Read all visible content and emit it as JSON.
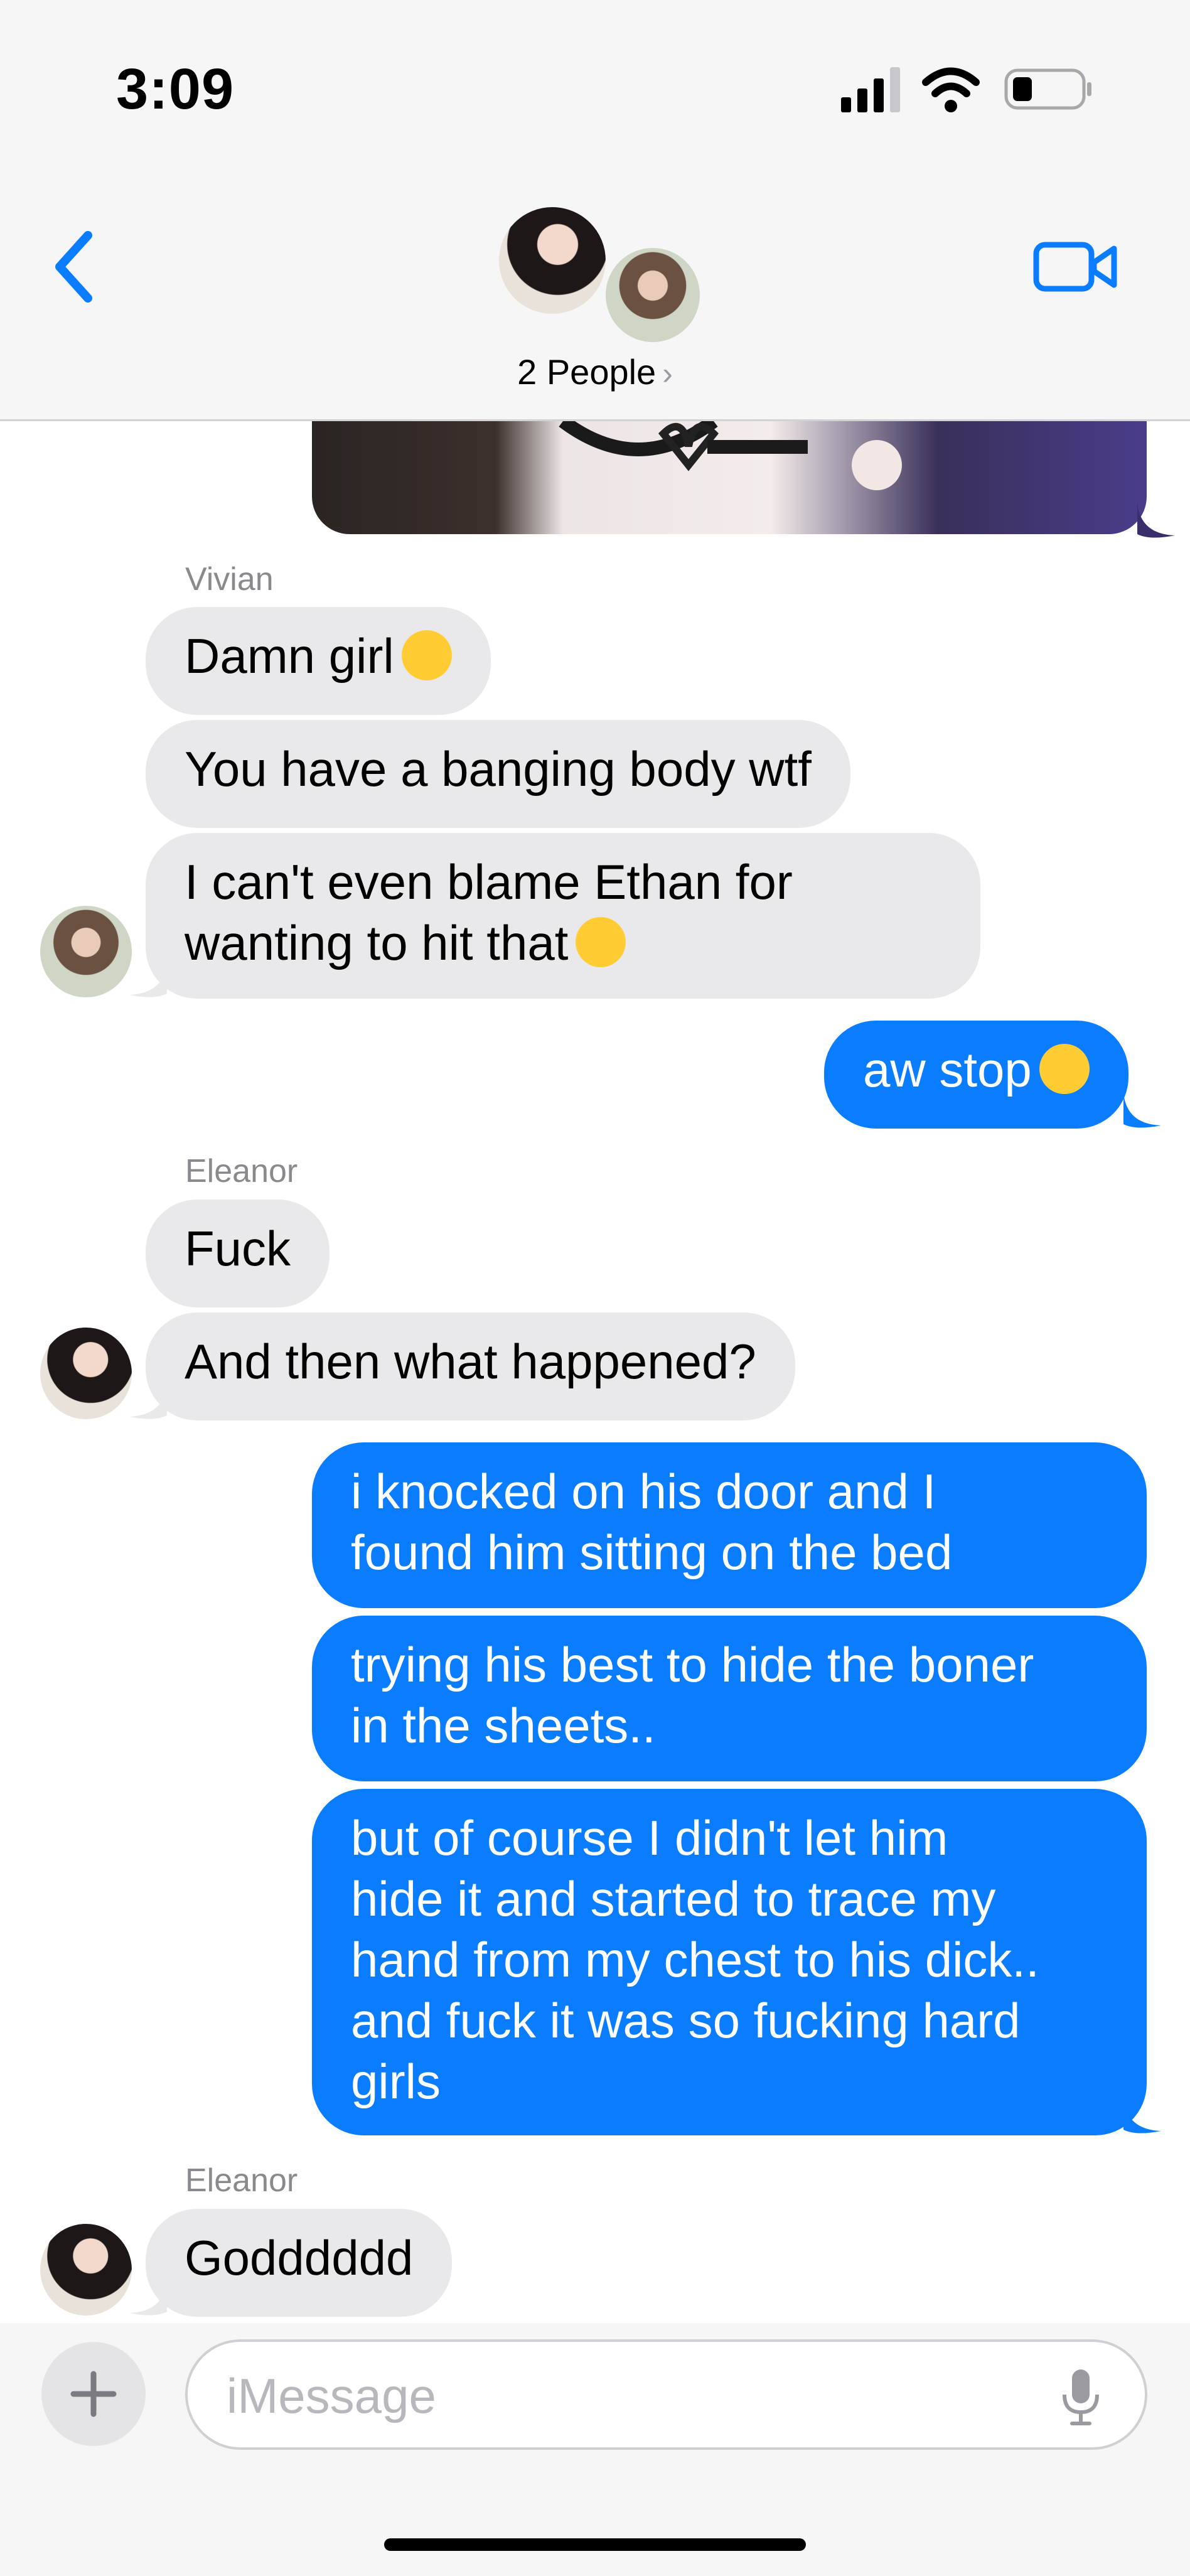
{
  "status_bar": {
    "time": "3:09",
    "battery_level": 0.25,
    "cellular_bars": 4,
    "wifi": "full"
  },
  "header": {
    "title": "2 People",
    "back_icon": "chevron-left-icon",
    "video_icon": "video-camera-icon"
  },
  "conversation": {
    "group_1": {
      "sender": "Vivian",
      "messages": [
        "Damn girl",
        "You have a banging body wtf",
        "I can't even blame Ethan for",
        "wanting to hit that"
      ],
      "emojis": [
        "face-exhaling-emoji",
        "woozy-face-emoji"
      ]
    },
    "out_1": {
      "text": "aw stop",
      "emoji": "weary-face-emoji"
    },
    "group_2": {
      "sender": "Eleanor",
      "messages": [
        "Fuck",
        "And then what happened?"
      ]
    },
    "out_2": {
      "messages": [
        [
          "i knocked on his door and I",
          "found him sitting on the bed"
        ],
        [
          "trying his best to hide the boner",
          "in the sheets.."
        ],
        [
          "but of course I didn't let him",
          "hide it and started to trace my",
          "hand from my chest to his dick..",
          "and fuck it was so fucking hard",
          "girls"
        ]
      ]
    },
    "group_3": {
      "sender": "Eleanor",
      "messages": [
        "Godddddd"
      ]
    }
  },
  "input": {
    "placeholder": "iMessage",
    "value": "",
    "plus_icon": "plus-icon",
    "mic_icon": "microphone-icon"
  },
  "colors": {
    "outgoing": "#0a7cff",
    "incoming": "#e9e9eb",
    "accent": "#0a7cff",
    "bar_bg": "#f6f6f6"
  }
}
